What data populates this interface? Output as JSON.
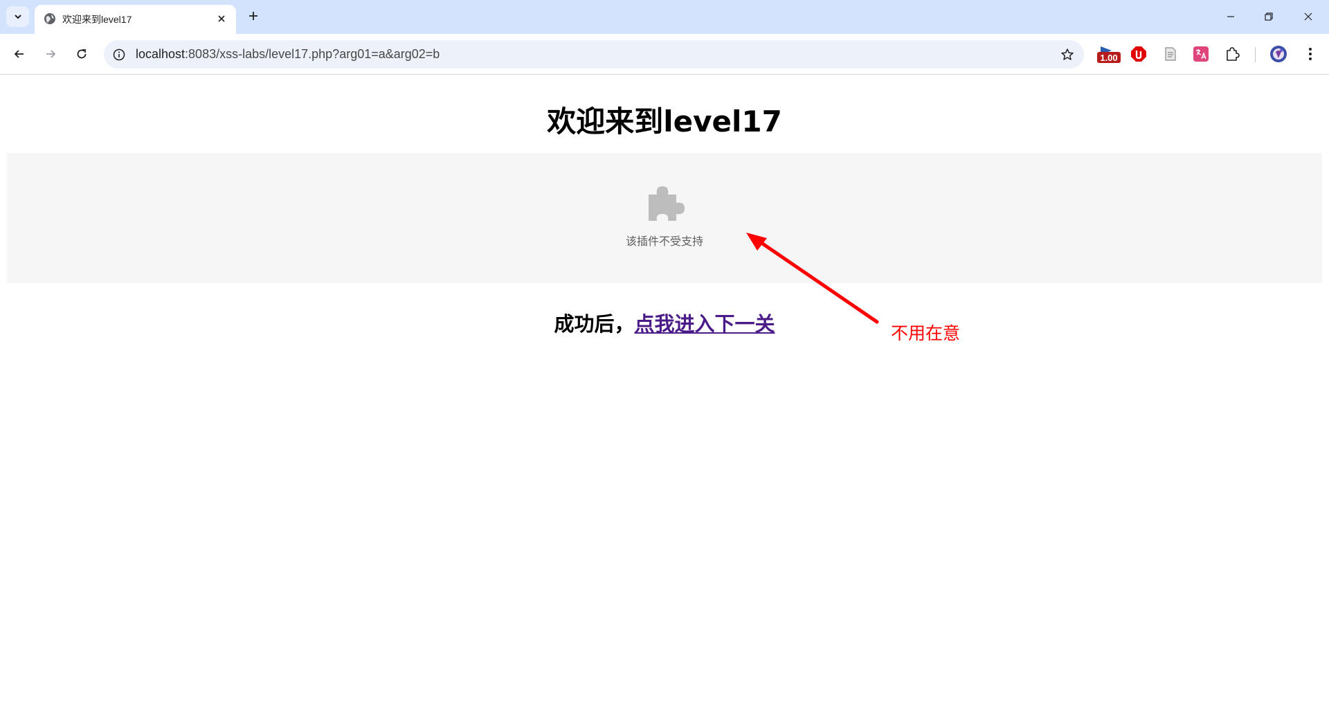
{
  "browser": {
    "tab": {
      "title": "欢迎来到level17"
    },
    "address_bar": {
      "url_host": "localhost",
      "url_rest": ":8083/xss-labs/level17.php?arg01=a&arg02=b"
    },
    "extensions": {
      "speed_badge": "1.00"
    }
  },
  "page": {
    "title": "欢迎来到level17",
    "plugin_message": "该插件不受支持",
    "next_prefix": "成功后，",
    "next_link": "点我进入下一关"
  },
  "annotation": {
    "text": "不用在意",
    "color": "#ff0000"
  },
  "colors": {
    "tabstrip_bg": "#d3e3fd",
    "omnibox_bg": "#edf2fa",
    "link_visited": "#4b1b8a",
    "plugin_bg": "#f6f6f6"
  }
}
